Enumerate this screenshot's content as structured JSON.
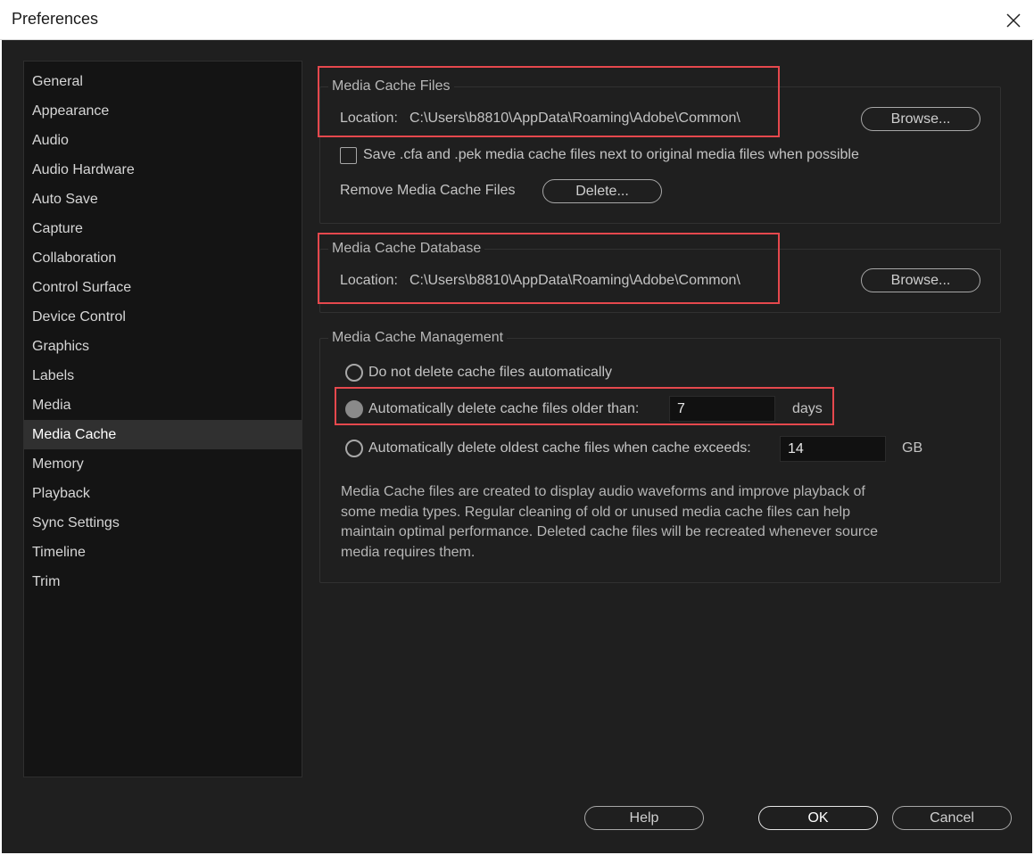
{
  "window": {
    "title": "Preferences"
  },
  "sidebar": {
    "items": [
      {
        "label": "General"
      },
      {
        "label": "Appearance"
      },
      {
        "label": "Audio"
      },
      {
        "label": "Audio Hardware"
      },
      {
        "label": "Auto Save"
      },
      {
        "label": "Capture"
      },
      {
        "label": "Collaboration"
      },
      {
        "label": "Control Surface"
      },
      {
        "label": "Device Control"
      },
      {
        "label": "Graphics"
      },
      {
        "label": "Labels"
      },
      {
        "label": "Media"
      },
      {
        "label": "Media Cache",
        "selected": true
      },
      {
        "label": "Memory"
      },
      {
        "label": "Playback"
      },
      {
        "label": "Sync Settings"
      },
      {
        "label": "Timeline"
      },
      {
        "label": "Trim"
      }
    ]
  },
  "cache_files": {
    "title": "Media Cache Files",
    "location_label": "Location:",
    "location_value": "C:\\Users\\b8810\\AppData\\Roaming\\Adobe\\Common\\",
    "browse_label": "Browse...",
    "save_checkbox_label": "Save .cfa and .pek media cache files next to original media files when possible",
    "save_checkbox_checked": false,
    "remove_label": "Remove Media Cache Files",
    "delete_label": "Delete..."
  },
  "cache_database": {
    "title": "Media Cache Database",
    "location_label": "Location:",
    "location_value": "C:\\Users\\b8810\\AppData\\Roaming\\Adobe\\Common\\",
    "browse_label": "Browse..."
  },
  "cache_management": {
    "title": "Media Cache Management",
    "option_no_delete": "Do not delete cache files automatically",
    "option_older_than": "Automatically delete cache files older than:",
    "older_than_value": "7",
    "older_than_unit": "days",
    "option_exceeds": "Automatically delete oldest cache files when cache exceeds:",
    "exceeds_value": "14",
    "exceeds_unit": "GB",
    "selected_option": "older_than",
    "description": "Media Cache files are created to display audio waveforms and improve playback of some media types.  Regular cleaning of old or unused media cache files can help maintain optimal performance. Deleted cache files will be recreated whenever source media requires them."
  },
  "footer": {
    "help_label": "Help",
    "ok_label": "OK",
    "cancel_label": "Cancel"
  },
  "colors": {
    "dialog_bg": "#1f1f1f",
    "sidebar_bg": "#141414",
    "highlight": "#e5484d"
  }
}
